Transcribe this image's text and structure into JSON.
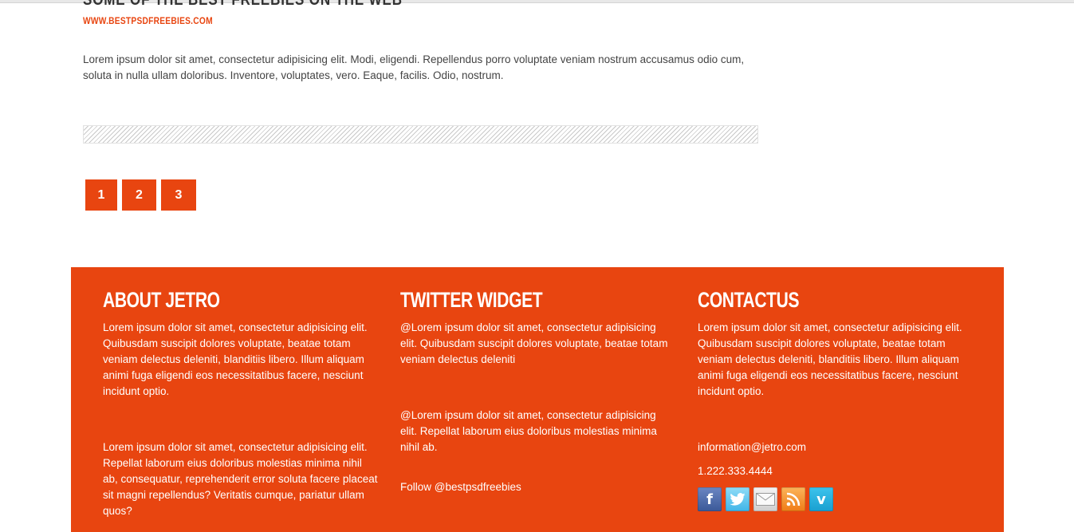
{
  "post": {
    "title": "Some of the best freebies on the web",
    "link": "WWW.BESTPSDFREEBIES.COM",
    "body": "Lorem ipsum dolor sit amet, consectetur adipisicing elit. Modi, eligendi. Repellendus porro voluptate veniam nostrum accusamus odio cum, soluta in nulla ullam doloribus. Inventore, voluptates, vero. Eaque, facilis. Odio, nostrum."
  },
  "pagination": {
    "pages": [
      "1",
      "2",
      "3"
    ]
  },
  "footer": {
    "about": {
      "title": "About Jetro",
      "p1": "Lorem ipsum dolor sit amet, consectetur adipisicing elit. Quibusdam suscipit dolores voluptate, beatae totam veniam delectus deleniti, blanditiis libero. Illum aliquam animi fuga eligendi eos necessitatibus facere, nesciunt incidunt optio.",
      "p2": "Lorem ipsum dolor sit amet, consectetur adipisicing elit. Repellat laborum eius doloribus molestias minima nihil ab, consequatur, reprehenderit error soluta facere placeat sit magni repellendus? Veritatis cumque, pariatur ullam quos?"
    },
    "twitter": {
      "title": "Twitter Widget",
      "tweet1": "@Lorem ipsum dolor sit amet, consectetur adipisicing elit. Quibusdam suscipit dolores voluptate, beatae totam veniam delectus deleniti",
      "tweet2": "@Lorem ipsum dolor sit amet, consectetur adipisicing elit. Repellat laborum eius doloribus molestias minima nihil ab.",
      "follow": "Follow @bestpsdfreebies"
    },
    "contact": {
      "title": "Contactus",
      "p1": "Lorem ipsum dolor sit amet, consectetur adipisicing elit. Quibusdam suscipit dolores voluptate, beatae totam veniam delectus deleniti, blanditiis libero. Illum aliquam animi fuga eligendi eos necessitatibus facere, nesciunt incidunt optio.",
      "email": "information@jetro.com",
      "phone": "1.222.333.4444",
      "social_icons": [
        "facebook-icon",
        "twitter-icon",
        "mail-icon",
        "rss-icon",
        "vimeo-icon"
      ]
    }
  },
  "colors": {
    "accent": "#e84510",
    "text": "#444444",
    "footer_text": "#ffffff"
  }
}
